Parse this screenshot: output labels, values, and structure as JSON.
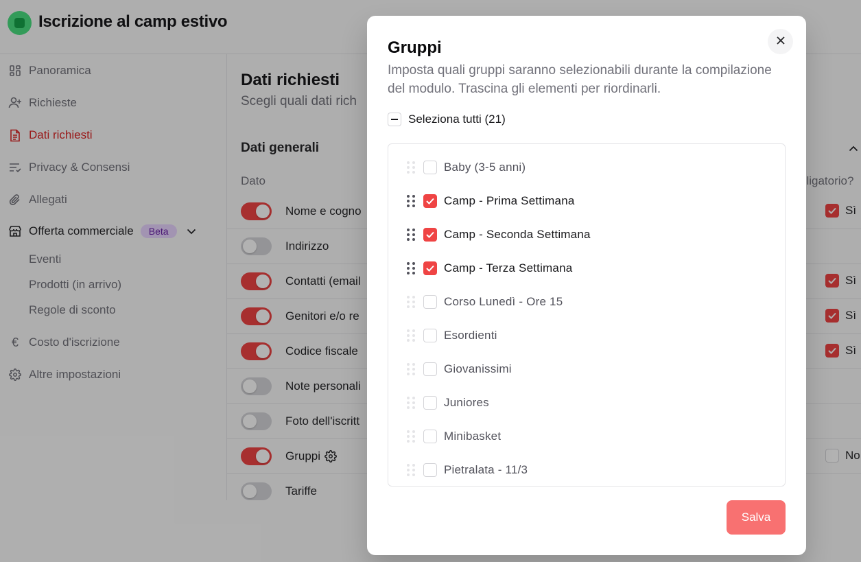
{
  "app": {
    "title": "Iscrizione al camp estivo"
  },
  "sidebar": {
    "items": [
      {
        "label": "Panoramica",
        "icon": "dashboard-icon"
      },
      {
        "label": "Richieste",
        "icon": "user-plus-icon"
      },
      {
        "label": "Dati richiesti",
        "icon": "document-icon",
        "active": true
      },
      {
        "label": "Privacy & Consensi",
        "icon": "list-icon"
      },
      {
        "label": "Allegati",
        "icon": "paperclip-icon"
      },
      {
        "label": "Offerta commerciale",
        "icon": "store-icon",
        "badge": "Beta"
      },
      {
        "label": "Costo d'iscrizione",
        "icon": "euro-icon"
      },
      {
        "label": "Altre impostazioni",
        "icon": "gear-icon"
      }
    ],
    "subitems": [
      "Eventi",
      "Prodotti (in arrivo)",
      "Regole di sconto"
    ]
  },
  "main": {
    "title": "Dati richiesti",
    "subtitle": "Scegli quali dati rich",
    "section_title": "Dati generali",
    "col_dato": "Dato",
    "col_obbligatorio": "bligatorio?",
    "rows": [
      {
        "label": "Nome e cogno",
        "enabled": true,
        "required": "Sì",
        "required_checked": true
      },
      {
        "label": "Indirizzo",
        "enabled": false
      },
      {
        "label": "Contatti (email",
        "enabled": true,
        "required": "Sì",
        "required_checked": true
      },
      {
        "label": "Genitori e/o re",
        "enabled": true,
        "required": "Sì",
        "required_checked": true
      },
      {
        "label": "Codice fiscale",
        "enabled": true,
        "required": "Sì",
        "required_checked": true
      },
      {
        "label": "Note personali",
        "enabled": false
      },
      {
        "label": "Foto dell'iscritt",
        "enabled": false
      },
      {
        "label": "Gruppi",
        "enabled": true,
        "required": "No",
        "required_checked": false
      },
      {
        "label": "Tariffe",
        "enabled": false
      }
    ]
  },
  "modal": {
    "title": "Gruppi",
    "description": "Imposta quali gruppi saranno selezionabili durante la compilazione del modulo. Trascina gli elementi per riordinarli.",
    "select_all_label": "Seleziona tutti (21)",
    "groups": [
      {
        "name": "Baby (3-5 anni)",
        "checked": false
      },
      {
        "name": "Camp - Prima Settimana",
        "checked": true
      },
      {
        "name": "Camp - Seconda Settimana",
        "checked": true
      },
      {
        "name": "Camp - Terza Settimana",
        "checked": true
      },
      {
        "name": "Corso Lunedì - Ore 15",
        "checked": false
      },
      {
        "name": "Esordienti",
        "checked": false
      },
      {
        "name": "Giovanissimi",
        "checked": false
      },
      {
        "name": "Juniores",
        "checked": false
      },
      {
        "name": "Minibasket",
        "checked": false
      },
      {
        "name": "Pietralata - 11/3",
        "checked": false
      }
    ],
    "save_label": "Salva"
  },
  "colors": {
    "accent": "#ef4444",
    "save_button": "#f87171",
    "logo": "#16a34a",
    "beta_badge": "#e9d5ff"
  }
}
